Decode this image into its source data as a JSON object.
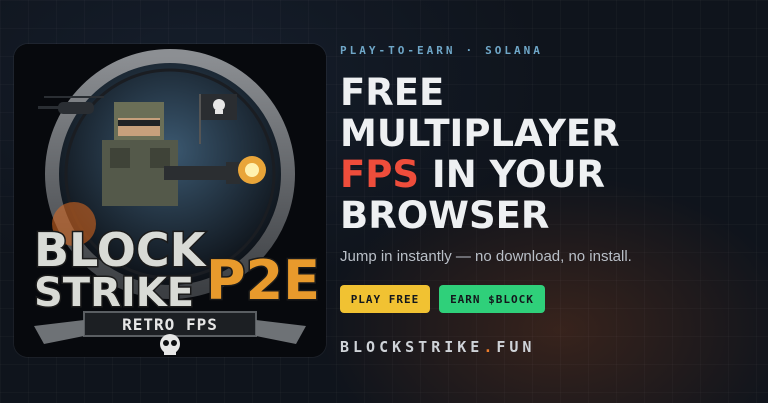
{
  "eyebrow": {
    "left": "PLAY-TO-EARN",
    "separator": "·",
    "right": "SOLANA"
  },
  "headline": {
    "line1": "FREE",
    "line2": "MULTIPLAYER",
    "highlight": "FPS",
    "line3_rest": " IN YOUR",
    "line4": "BROWSER"
  },
  "subtitle": "Jump in instantly — no download, no install.",
  "buttons": {
    "play": "PLAY FREE",
    "earn": "EARN $BLOCK"
  },
  "domain": {
    "name": "BLOCKSTRIKE",
    "dot": ".",
    "tld": "FUN"
  },
  "art": {
    "logo_line1": "BLOCK",
    "logo_line2": "STRIKE",
    "logo_badge": "P2E",
    "logo_sub": "RETRO FPS"
  },
  "colors": {
    "accent_red": "#ee4d3b",
    "play_yellow": "#f1c232",
    "earn_green": "#2fd07a",
    "eyebrow_blue": "#6fa7c8",
    "background": "#0f141c"
  }
}
